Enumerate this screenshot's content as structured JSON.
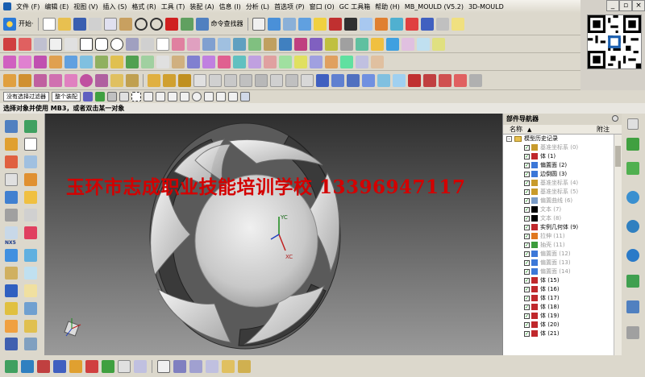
{
  "menubar": {
    "items": [
      "文件 (F)",
      "编辑 (E)",
      "视图 (V)",
      "插入 (S)",
      "格式 (R)",
      "工具 (T)",
      "装配 (A)",
      "信息 (I)",
      "分析 (L)",
      "首选项 (P)",
      "窗口 (O)",
      "GC 工具箱",
      "帮助 (H)",
      "MB_MOULD (V5.2)",
      "3D-MOULD"
    ],
    "window_controls": [
      "_",
      "▫",
      "×"
    ]
  },
  "toolbar1": {
    "start_label": "开始·",
    "command_finder_label": "命令查找器"
  },
  "selection_bar": {
    "filter": "没有选择过滤器",
    "scope": "整个装配"
  },
  "status": {
    "prompt": "选择对象并使用 MB3，或者双击某一对象"
  },
  "viewport": {
    "watermark": "玉环市志成职业技能培训学校  13396947117",
    "triad": {
      "y_label": "YC",
      "x_label": "XC"
    }
  },
  "left_toolbar": {
    "nx5_label": "NX5"
  },
  "navigator": {
    "title": "部件导航器",
    "col_name": "名称",
    "col_sort": "▲",
    "col_attach": "附注",
    "root": "模型历史记录",
    "items": [
      {
        "label": "基准坐标系 (0)",
        "dim": true,
        "icon": "datum-csys-icon",
        "color": "#c89b2c"
      },
      {
        "label": "体 (1)",
        "dim": false,
        "icon": "body-icon",
        "color": "#c0282c"
      },
      {
        "label": "偏置面 (2)",
        "dim": false,
        "icon": "offset-face-icon",
        "color": "#3c78d8"
      },
      {
        "label": "边倒圆 (3)",
        "dim": false,
        "icon": "edge-blend-icon",
        "color": "#3c78d8"
      },
      {
        "label": "基准坐标系 (4)",
        "dim": true,
        "icon": "datum-csys-icon",
        "color": "#c89b2c"
      },
      {
        "label": "基准坐标系 (5)",
        "dim": true,
        "icon": "datum-csys-icon",
        "color": "#c89b2c"
      },
      {
        "label": "偏置曲线 (6)",
        "dim": true,
        "icon": "offset-curve-icon",
        "color": "#7a9cc8"
      },
      {
        "label": "文本 (7)",
        "dim": true,
        "icon": "text-icon",
        "color": "#000000"
      },
      {
        "label": "文本 (8)",
        "dim": true,
        "icon": "text-icon",
        "color": "#000000"
      },
      {
        "label": "实例几何体 (9)",
        "dim": false,
        "icon": "instance-geometry-icon",
        "color": "#c0282c"
      },
      {
        "label": "拉伸 (11)",
        "dim": true,
        "icon": "extrude-icon",
        "color": "#e07820"
      },
      {
        "label": "抽壳 (11)",
        "dim": true,
        "icon": "shell-icon",
        "color": "#3c9c3c"
      },
      {
        "label": "偏置面 (12)",
        "dim": true,
        "icon": "offset-face-icon",
        "color": "#3c78d8"
      },
      {
        "label": "偏置面 (13)",
        "dim": true,
        "icon": "offset-face-icon",
        "color": "#3c78d8"
      },
      {
        "label": "偏置面 (14)",
        "dim": true,
        "icon": "offset-face-icon",
        "color": "#3c78d8"
      },
      {
        "label": "体 (15)",
        "dim": false,
        "icon": "body-icon",
        "color": "#c0282c"
      },
      {
        "label": "体 (16)",
        "dim": false,
        "icon": "body-icon",
        "color": "#c0282c"
      },
      {
        "label": "体 (17)",
        "dim": false,
        "icon": "body-icon",
        "color": "#c0282c"
      },
      {
        "label": "体 (18)",
        "dim": false,
        "icon": "body-icon",
        "color": "#c0282c"
      },
      {
        "label": "体 (19)",
        "dim": false,
        "icon": "body-icon",
        "color": "#c0282c"
      },
      {
        "label": "体 (20)",
        "dim": false,
        "icon": "body-icon",
        "color": "#c0282c"
      },
      {
        "label": "体 (21)",
        "dim": false,
        "icon": "body-icon",
        "color": "#c0282c"
      }
    ]
  },
  "colors": {
    "watermark": "#d40000",
    "viewport_top": "#2e2e2e",
    "viewport_bottom": "#9a9a9a",
    "panel_bg": "#d4d0c8"
  }
}
